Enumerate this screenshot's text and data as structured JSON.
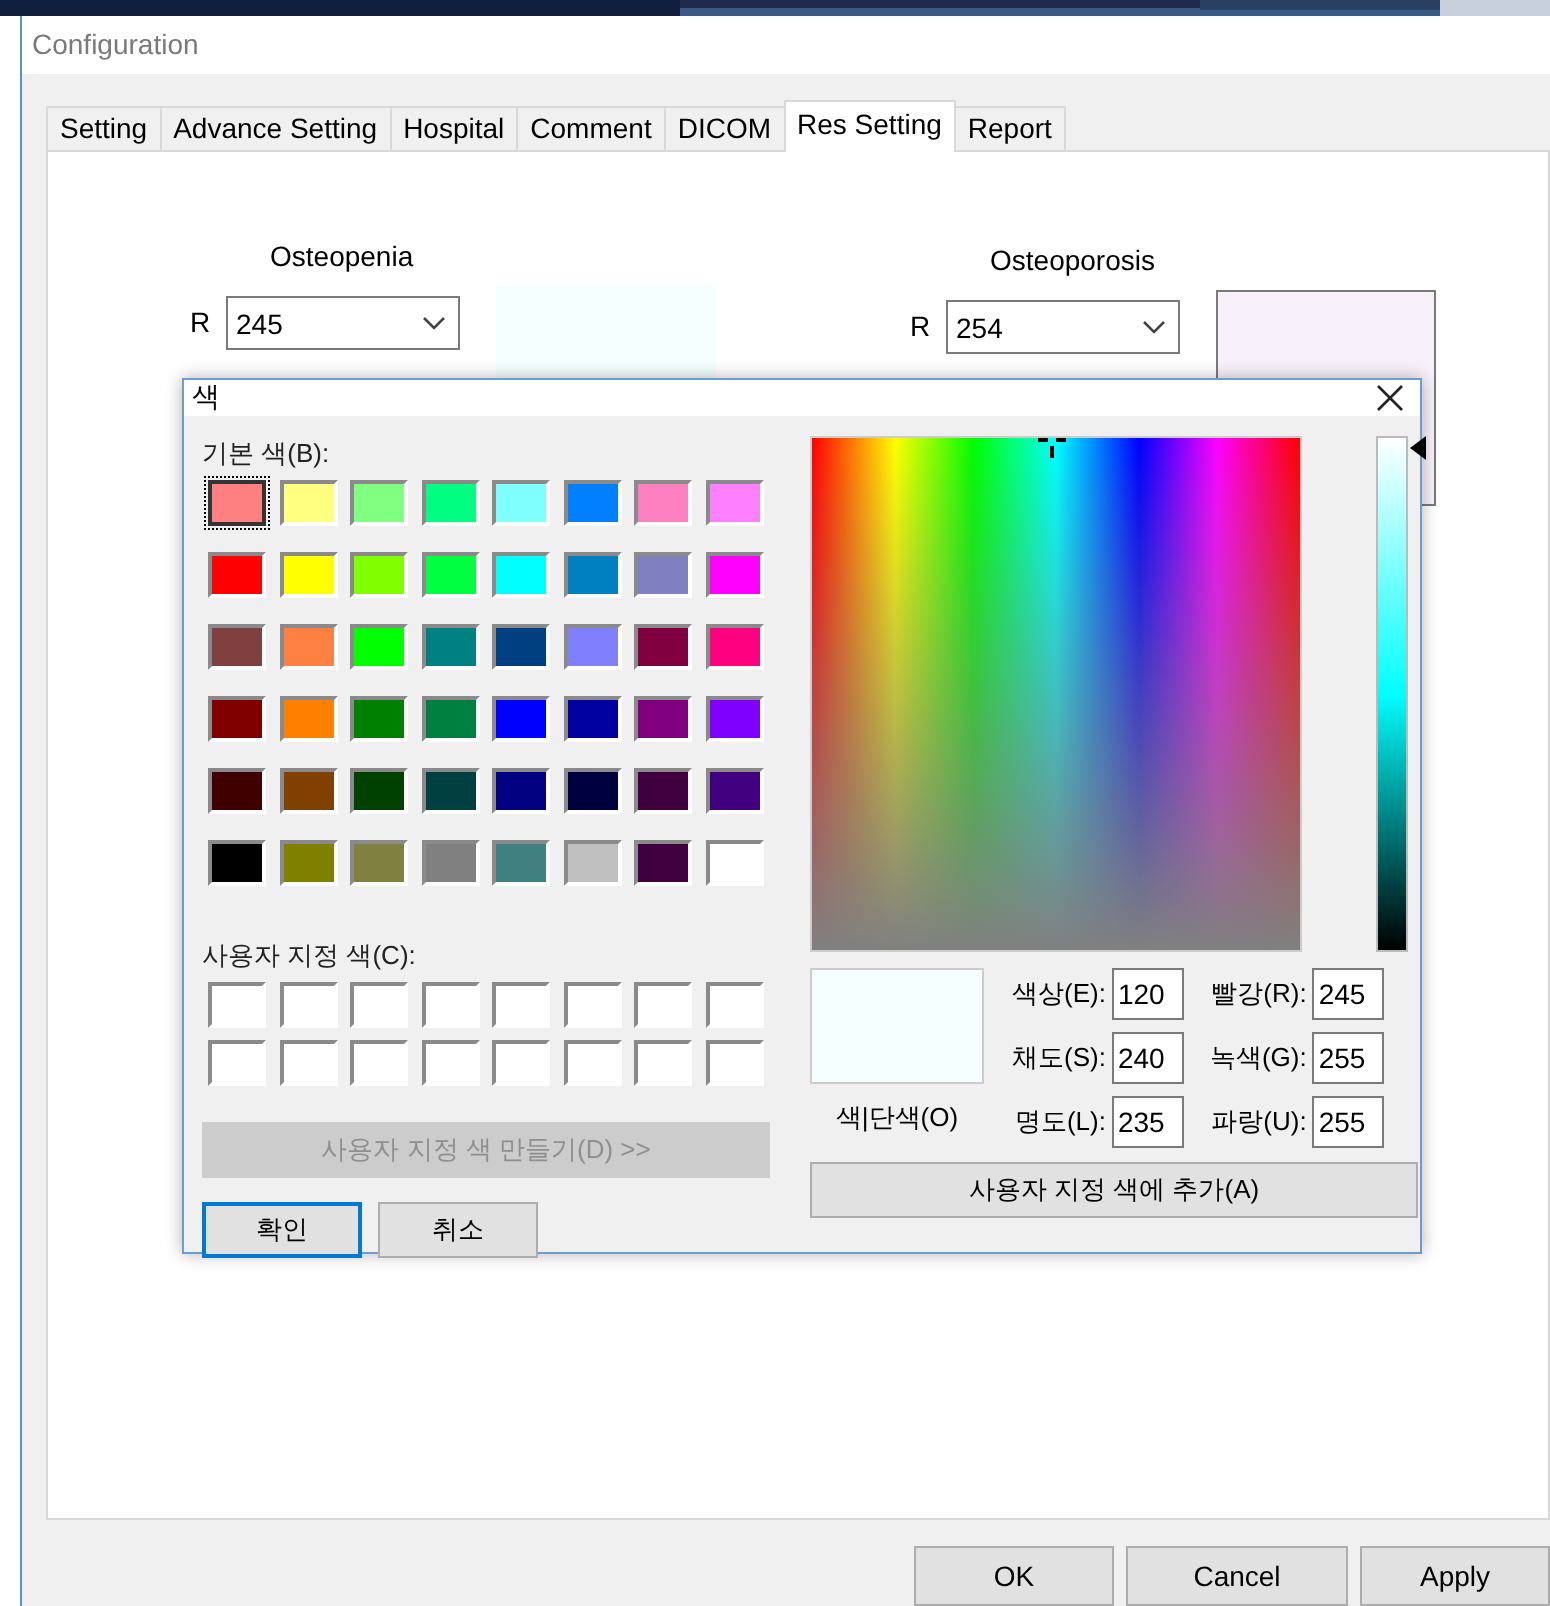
{
  "window": {
    "title": "Configuration"
  },
  "tabs": [
    {
      "label": "Setting",
      "selected": false
    },
    {
      "label": "Advance Setting",
      "selected": false
    },
    {
      "label": "Hospital",
      "selected": false
    },
    {
      "label": "Comment",
      "selected": false
    },
    {
      "label": "DICOM",
      "selected": false
    },
    {
      "label": "Res Setting",
      "selected": true
    },
    {
      "label": "Report",
      "selected": false
    }
  ],
  "groups": [
    {
      "title": "Osteopenia",
      "channel": "R",
      "value": "245",
      "color": "#f5ffff",
      "bordered": false
    },
    {
      "title": "Osteoporosis",
      "channel": "R",
      "value": "254",
      "color": "#f8f0fa",
      "bordered": true
    }
  ],
  "color_dialog": {
    "title": "색",
    "basic_label": "기본 색(B):",
    "basic_colors": [
      {
        "color": "#ff8080",
        "selected": true
      },
      {
        "color": "#ffff80",
        "selected": false
      },
      {
        "color": "#80ff80",
        "selected": false
      },
      {
        "color": "#00ff80",
        "selected": false
      },
      {
        "color": "#80ffff",
        "selected": false
      },
      {
        "color": "#0080ff",
        "selected": false
      },
      {
        "color": "#ff80c0",
        "selected": false
      },
      {
        "color": "#ff80ff",
        "selected": false
      },
      {
        "color": "#ff0000",
        "selected": false
      },
      {
        "color": "#ffff00",
        "selected": false
      },
      {
        "color": "#80ff00",
        "selected": false
      },
      {
        "color": "#00ff40",
        "selected": false
      },
      {
        "color": "#00ffff",
        "selected": false
      },
      {
        "color": "#0080c0",
        "selected": false
      },
      {
        "color": "#8080c0",
        "selected": false
      },
      {
        "color": "#ff00ff",
        "selected": false
      },
      {
        "color": "#804040",
        "selected": false
      },
      {
        "color": "#ff8040",
        "selected": false
      },
      {
        "color": "#00ff00",
        "selected": false
      },
      {
        "color": "#008080",
        "selected": false
      },
      {
        "color": "#004080",
        "selected": false
      },
      {
        "color": "#8080ff",
        "selected": false
      },
      {
        "color": "#800040",
        "selected": false
      },
      {
        "color": "#ff0080",
        "selected": false
      },
      {
        "color": "#800000",
        "selected": false
      },
      {
        "color": "#ff8000",
        "selected": false
      },
      {
        "color": "#008000",
        "selected": false
      },
      {
        "color": "#008040",
        "selected": false
      },
      {
        "color": "#0000ff",
        "selected": false
      },
      {
        "color": "#0000a0",
        "selected": false
      },
      {
        "color": "#800080",
        "selected": false
      },
      {
        "color": "#8000ff",
        "selected": false
      },
      {
        "color": "#400000",
        "selected": false
      },
      {
        "color": "#804000",
        "selected": false
      },
      {
        "color": "#004000",
        "selected": false
      },
      {
        "color": "#004040",
        "selected": false
      },
      {
        "color": "#000080",
        "selected": false
      },
      {
        "color": "#000040",
        "selected": false
      },
      {
        "color": "#400040",
        "selected": false
      },
      {
        "color": "#400080",
        "selected": false
      },
      {
        "color": "#000000",
        "selected": false
      },
      {
        "color": "#808000",
        "selected": false
      },
      {
        "color": "#808040",
        "selected": false
      },
      {
        "color": "#808080",
        "selected": false
      },
      {
        "color": "#408080",
        "selected": false
      },
      {
        "color": "#c0c0c0",
        "selected": false
      },
      {
        "color": "#400040",
        "selected": false
      },
      {
        "color": "#ffffff",
        "selected": false
      }
    ],
    "custom_label": "사용자 지정 색(C):",
    "custom_colors": [
      {
        "color": "#ffffff"
      },
      {
        "color": "#ffffff"
      },
      {
        "color": "#ffffff"
      },
      {
        "color": "#ffffff"
      },
      {
        "color": "#ffffff"
      },
      {
        "color": "#ffffff"
      },
      {
        "color": "#ffffff"
      },
      {
        "color": "#ffffff"
      },
      {
        "color": "#ffffff"
      },
      {
        "color": "#ffffff"
      },
      {
        "color": "#ffffff"
      },
      {
        "color": "#ffffff"
      },
      {
        "color": "#ffffff"
      },
      {
        "color": "#ffffff"
      },
      {
        "color": "#ffffff"
      },
      {
        "color": "#ffffff"
      }
    ],
    "define_button": {
      "label": "사용자 지정 색 만들기(D) >>",
      "disabled": true
    },
    "ok_button": "확인",
    "cancel_button": "취소",
    "luminance_slider": {
      "level": 0.98
    },
    "preview": {
      "color": "#f5ffff",
      "label": "색|단색(O)"
    },
    "fields": [
      {
        "label": "색상(E):",
        "value": "120"
      },
      {
        "label": "빨강(R):",
        "value": "245"
      },
      {
        "label": "채도(S):",
        "value": "240"
      },
      {
        "label": "녹색(G):",
        "value": "255"
      },
      {
        "label": "명도(L):",
        "value": "235"
      },
      {
        "label": "파랑(U):",
        "value": "255"
      }
    ],
    "add_button": "사용자 지정 색에 추가(A)"
  },
  "buttons": [
    "OK",
    "Cancel",
    "Apply"
  ]
}
